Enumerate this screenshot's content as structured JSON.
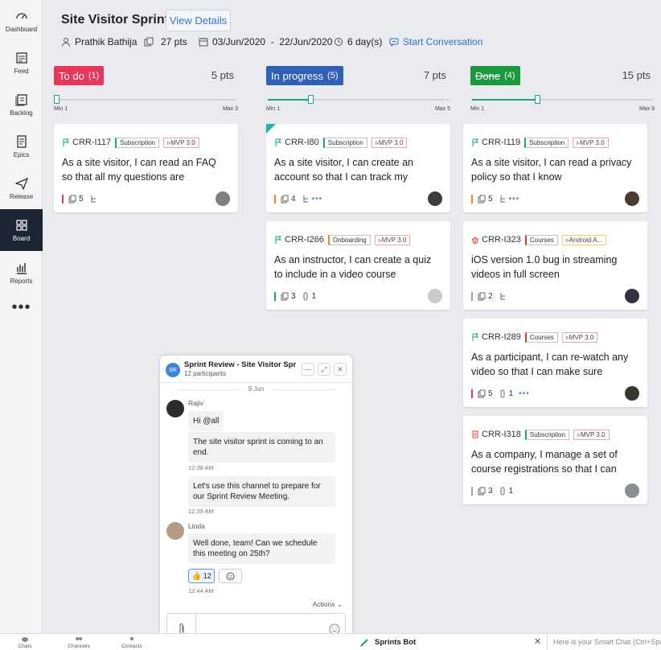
{
  "sidebar": {
    "items": [
      {
        "label": "Dashboard",
        "icon": "dashboard-icon"
      },
      {
        "label": "Feed",
        "icon": "feed-icon"
      },
      {
        "label": "Backlog",
        "icon": "backlog-icon"
      },
      {
        "label": "Epics",
        "icon": "epics-icon"
      },
      {
        "label": "Release",
        "icon": "release-icon"
      },
      {
        "label": "Board",
        "icon": "board-icon",
        "active": true
      },
      {
        "label": "Reports",
        "icon": "reports-icon"
      }
    ],
    "more": "•••"
  },
  "header": {
    "title": "Site Visitor Sprint",
    "view_details": "View Details",
    "owner": "Prathik Bathija",
    "points": "27 pts",
    "dates": "03/Jun/2020  -  22/Jun/2020",
    "duration": "6 day(s)",
    "start_conversation": "Start Conversation"
  },
  "columns": [
    {
      "status": "To do",
      "count": "(1)",
      "color": "#e8365d",
      "points": "5 pts",
      "slider": {
        "min": "Min 1",
        "max": "Max 3",
        "level": 0.0
      },
      "cards": [
        {
          "id": "CRR-I117",
          "tags": [
            "Subscription",
            "MVP 3.0"
          ],
          "desc": "As a site visitor, I can read an FAQ so that all my questions are",
          "priority": "#e8365d",
          "points": "5",
          "subtasks": "",
          "dots": false,
          "new": false
        }
      ]
    },
    {
      "status": "In progress",
      "count": "(5)",
      "color": "#2f5fb6",
      "points": "7 pts",
      "slider": {
        "min": "Min 1",
        "max": "Max 5",
        "level": 0.25
      },
      "cards": [
        {
          "id": "CRR-I80",
          "tags": [
            "Subscription",
            "MVP 3.0"
          ],
          "desc": "As a site visitor, I can create an account so that I can track my",
          "priority": "#e38a23",
          "points": "4",
          "subtasks": "",
          "dots": true,
          "new": true
        },
        {
          "id": "CRR-I266",
          "tags": [
            "Onboarding",
            "MVP 3.0"
          ],
          "desc": "As an instructor, I can create a quiz to include in a video course",
          "priority": "#1aa087",
          "points": "3",
          "subtasks": "1",
          "dots": false,
          "new": false
        }
      ]
    },
    {
      "status": "Done",
      "count": "(4)",
      "color": "#1a9a3f",
      "points": "15 pts",
      "slider": {
        "min": "Min 1",
        "max": "Max 9",
        "level": 0.375
      },
      "cards": [
        {
          "id": "CRR-I119",
          "tags": [
            "Subscription",
            "MVP 3.0"
          ],
          "desc": "As a site visitor, I can read a privacy policy so that I know",
          "priority": "#e38a23",
          "points": "5",
          "subtasks": "",
          "dots": true,
          "new": false
        },
        {
          "id": "CRR-I323",
          "tags": [
            "Courses",
            "Android A..."
          ],
          "desc": "iOS version 1.0 bug in streaming videos in full screen",
          "priority": "#9ea3aa",
          "points": "2",
          "subtasks": "",
          "dots": false,
          "new": false
        },
        {
          "id": "CRR-I289",
          "tags": [
            "Courses",
            "MVP 3.0"
          ],
          "desc": "As a participant, I can re-watch any video so that I can make sure",
          "priority": "#e8365d",
          "points": "5",
          "subtasks": "1",
          "dots": true,
          "new": false
        },
        {
          "id": "CRR-I318",
          "tags": [
            "Subscription",
            "MVP 3.0"
          ],
          "desc": "As a company, I manage a set of course registrations so that I can",
          "priority": "#9ea3aa",
          "points": "3",
          "subtasks": "1",
          "dots": false,
          "new": false
        }
      ]
    }
  ],
  "chat": {
    "avatar": "SR",
    "title": "Sprint Review - Site Visitor Spr",
    "participants": "12 participants",
    "date": "9 Jun",
    "messages": [
      {
        "sender": "Rajiv",
        "text": "Hi @all"
      },
      {
        "text": "The site visitor sprint is coming to an end.",
        "time": "12:38 AM"
      },
      {
        "text": "Let's use this channel to prepare for our Sprint Review Meeting.",
        "time": "12:39 AM"
      },
      {
        "sender": "Linda",
        "text": "Well done, team! Can we schedule this meeting on 25th?",
        "time": "12:44 AM"
      }
    ],
    "reaction_count": "12",
    "actions": "Actions"
  },
  "bottombar": {
    "chats": "Chats",
    "channels": "Channels",
    "contacts": "Contacts",
    "bot": "Sprints Bot",
    "smart_chat": "Here is your Smart Chat (Ctrl+Space)"
  }
}
